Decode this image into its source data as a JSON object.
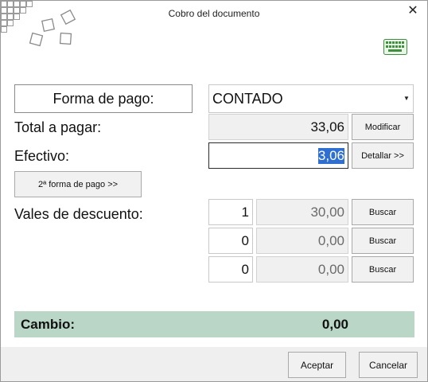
{
  "window": {
    "title": "Cobro del documento",
    "close_glyph": "✕"
  },
  "payment": {
    "method_label": "Forma de pago:",
    "method_value": "CONTADO",
    "total_label": "Total a pagar:",
    "total_value": "33,06",
    "modify_button": "Modificar",
    "cash_label": "Efectivo:",
    "cash_value_prefix": "3",
    "cash_value_selected": "3,06",
    "detail_button": "Detallar >>",
    "second_method_button": "2ª forma de pago >>"
  },
  "vouchers": {
    "label": "Vales de descuento:",
    "rows": [
      {
        "qty": "1",
        "amount": "30,00",
        "button": "Buscar"
      },
      {
        "qty": "0",
        "amount": "0,00",
        "button": "Buscar"
      },
      {
        "qty": "0",
        "amount": "0,00",
        "button": "Buscar"
      }
    ]
  },
  "change": {
    "label": "Cambio:",
    "value": "0,00"
  },
  "footer": {
    "accept": "Aceptar",
    "cancel": "Cancelar"
  },
  "icons": {
    "logo": "squares-logo-icon",
    "keyboard": "keyboard-icon",
    "dropdown": "chevron-down-icon"
  },
  "colors": {
    "change_bar": "#b9d6c7",
    "selection": "#2f6fd1",
    "keyboard_icon": "#3f8f3f"
  }
}
